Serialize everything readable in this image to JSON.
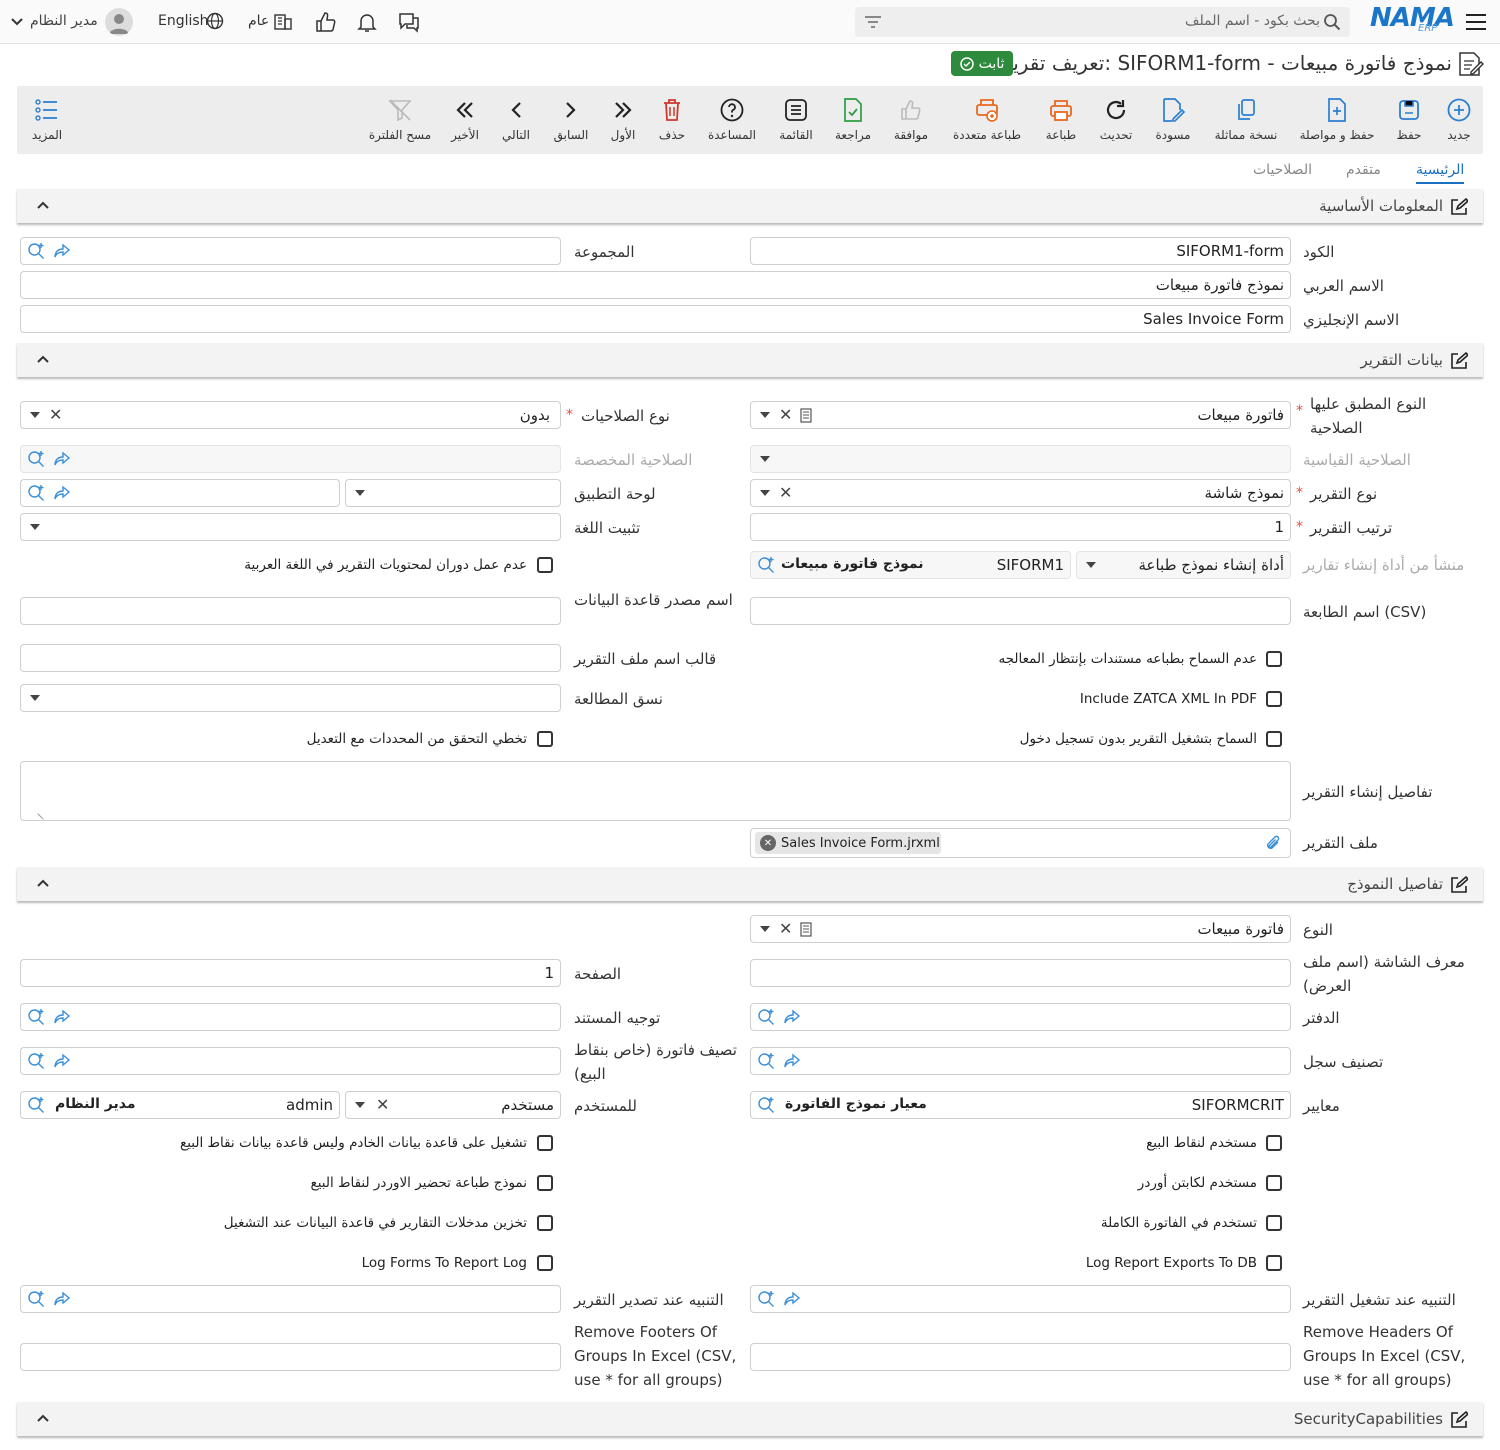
{
  "topbar": {
    "brand": "NAMA",
    "brand_sub": "ERP",
    "search_placeholder": "بحث بكود - اسم الملف",
    "user": "مدير النظام",
    "language": "English",
    "scope": "عام"
  },
  "title": {
    "text": "تعريف تقرير: SIFORM1-form - نموذج فاتورة مبيعات",
    "badge": "ثابت"
  },
  "toolbar": {
    "new": "جديد",
    "save": "حفظ",
    "save_continue": "حفظ و مواصلة",
    "copy": "نسخة مماثلة",
    "draft": "مسودة",
    "refresh": "تحديث",
    "print": "طباعة",
    "multi_print": "طباعة متعددة",
    "approve": "موافقة",
    "review": "مراجعة",
    "list": "القائمة",
    "help": "المساعدة",
    "delete": "حذف",
    "first": "الأول",
    "previous": "السابق",
    "next": "التالي",
    "last": "الأخير",
    "clear_filter": "مسح الفلترة",
    "more": "المزيد"
  },
  "tabs": [
    "الرئيسية",
    "متقدم",
    "الصلاحيات"
  ],
  "sections": {
    "basic": "المعلومات الأساسية",
    "report_data": "بيانات التقرير",
    "form_details": "تفاصيل النموذج",
    "security": "SecurityCapabilities"
  },
  "basic": {
    "code_label": "الكود",
    "code": "SIFORM1-form",
    "group_label": "المجموعة",
    "arabic_name_label": "الاسم العربي",
    "arabic_name": "نموذج فاتورة مبيعات",
    "english_name_label": "الاسم الإنجليزي",
    "english_name": "Sales Invoice Form"
  },
  "report": {
    "applied_type_label": "النوع المطبق عليها الصلاحية",
    "applied_type": "فاتورة مبيعات",
    "perm_type_label": "نوع الصلاحيات",
    "perm_type": "بدون",
    "std_perm_label": "الصلاحية القياسية",
    "custom_perm_label": "الصلاحية المخصصة",
    "report_type_label": "نوع التقرير",
    "report_type": "نموذج شاشة",
    "app_board_label": "لوحة التطبيق",
    "report_order_label": "ترتيب التقرير",
    "report_order": "1",
    "lang_fix_label": "تثبيت اللغة",
    "origin_label": "منشأ من أداة إنشاء تقارير",
    "origin_tool": "أداة إنشاء نموذج طباعة",
    "origin_code": "SIFORM1",
    "origin_name": "نموذج فاتورة مبيعات",
    "no_rotate_label": "عدم عمل دوران لمحتويات التقرير في اللغة العربية",
    "printer_label": "اسم الطابعة (CSV)",
    "db_source_label": "اسم مصدر قاعدة البيانات",
    "no_pending_print_label": "عدم السماح بطباعه مستندات بإنتظار المعالجه",
    "filename_template_label": "قالب اسم ملف التقرير",
    "zatca_label": "Include ZATCA XML In PDF",
    "match_format_label": "نسق المطالعة",
    "run_without_login_label": "السماح بتشغيل التقرير بدون تسجيل دخول",
    "skip_validation_label": "تخطي التحقق من المحددات مع التعديل",
    "details_label": "تفاصيل إنشاء التقرير",
    "file_label": "ملف التقرير",
    "file": "Sales Invoice Form.jrxml"
  },
  "form": {
    "type_label": "النوع",
    "type": "فاتورة مبيعات",
    "screen_id_label": "معرف الشاشة (اسم ملف العرض)",
    "page_label": "الصفحة",
    "page": "1",
    "book_label": "الدفتر",
    "doc_route_label": "توجيه المستند",
    "record_class_label": "تصنيف سجل",
    "pos_invoice_class_label": "تصيف فاتورة (خاص بنقاط البيع)",
    "criteria_label": "معايير",
    "criteria_code": "SIFORMCRIT",
    "criteria_name": "معيار نموذج الفاتورة",
    "user_label": "للمستخدم",
    "user_type": "مستخدم",
    "user_code": "admin",
    "user_name": "مدير النظام",
    "pos_use_label": "مستخدم لنقاط البيع",
    "server_db_label": "تشغيل على قاعدة بيانات الخادم وليس قاعدة بيانات نقاط البيع",
    "order_captain_label": "مستخدم لكابتن أوردر",
    "order_prep_label": "نموذج طباعة تحضير الاوردر لنقاط البيع",
    "full_invoice_label": "تستخدم في الفاتورة الكاملة",
    "store_inputs_label": "تخزين مدخلات التقارير في قاعدة البيانات عند التشغيل",
    "log_exports_label": "Log Report Exports To DB",
    "log_forms_label": "Log Forms To Report Log",
    "notify_run_label": "التنبيه عند تشغيل التقرير",
    "notify_export_label": "التنبيه عند تصدير التقرير",
    "remove_headers_label": "Remove Headers Of Groups In Excel (CSV, use * for all groups)",
    "remove_footers_label": "Remove Footers Of Groups In Excel (CSV, use * for all groups)"
  }
}
